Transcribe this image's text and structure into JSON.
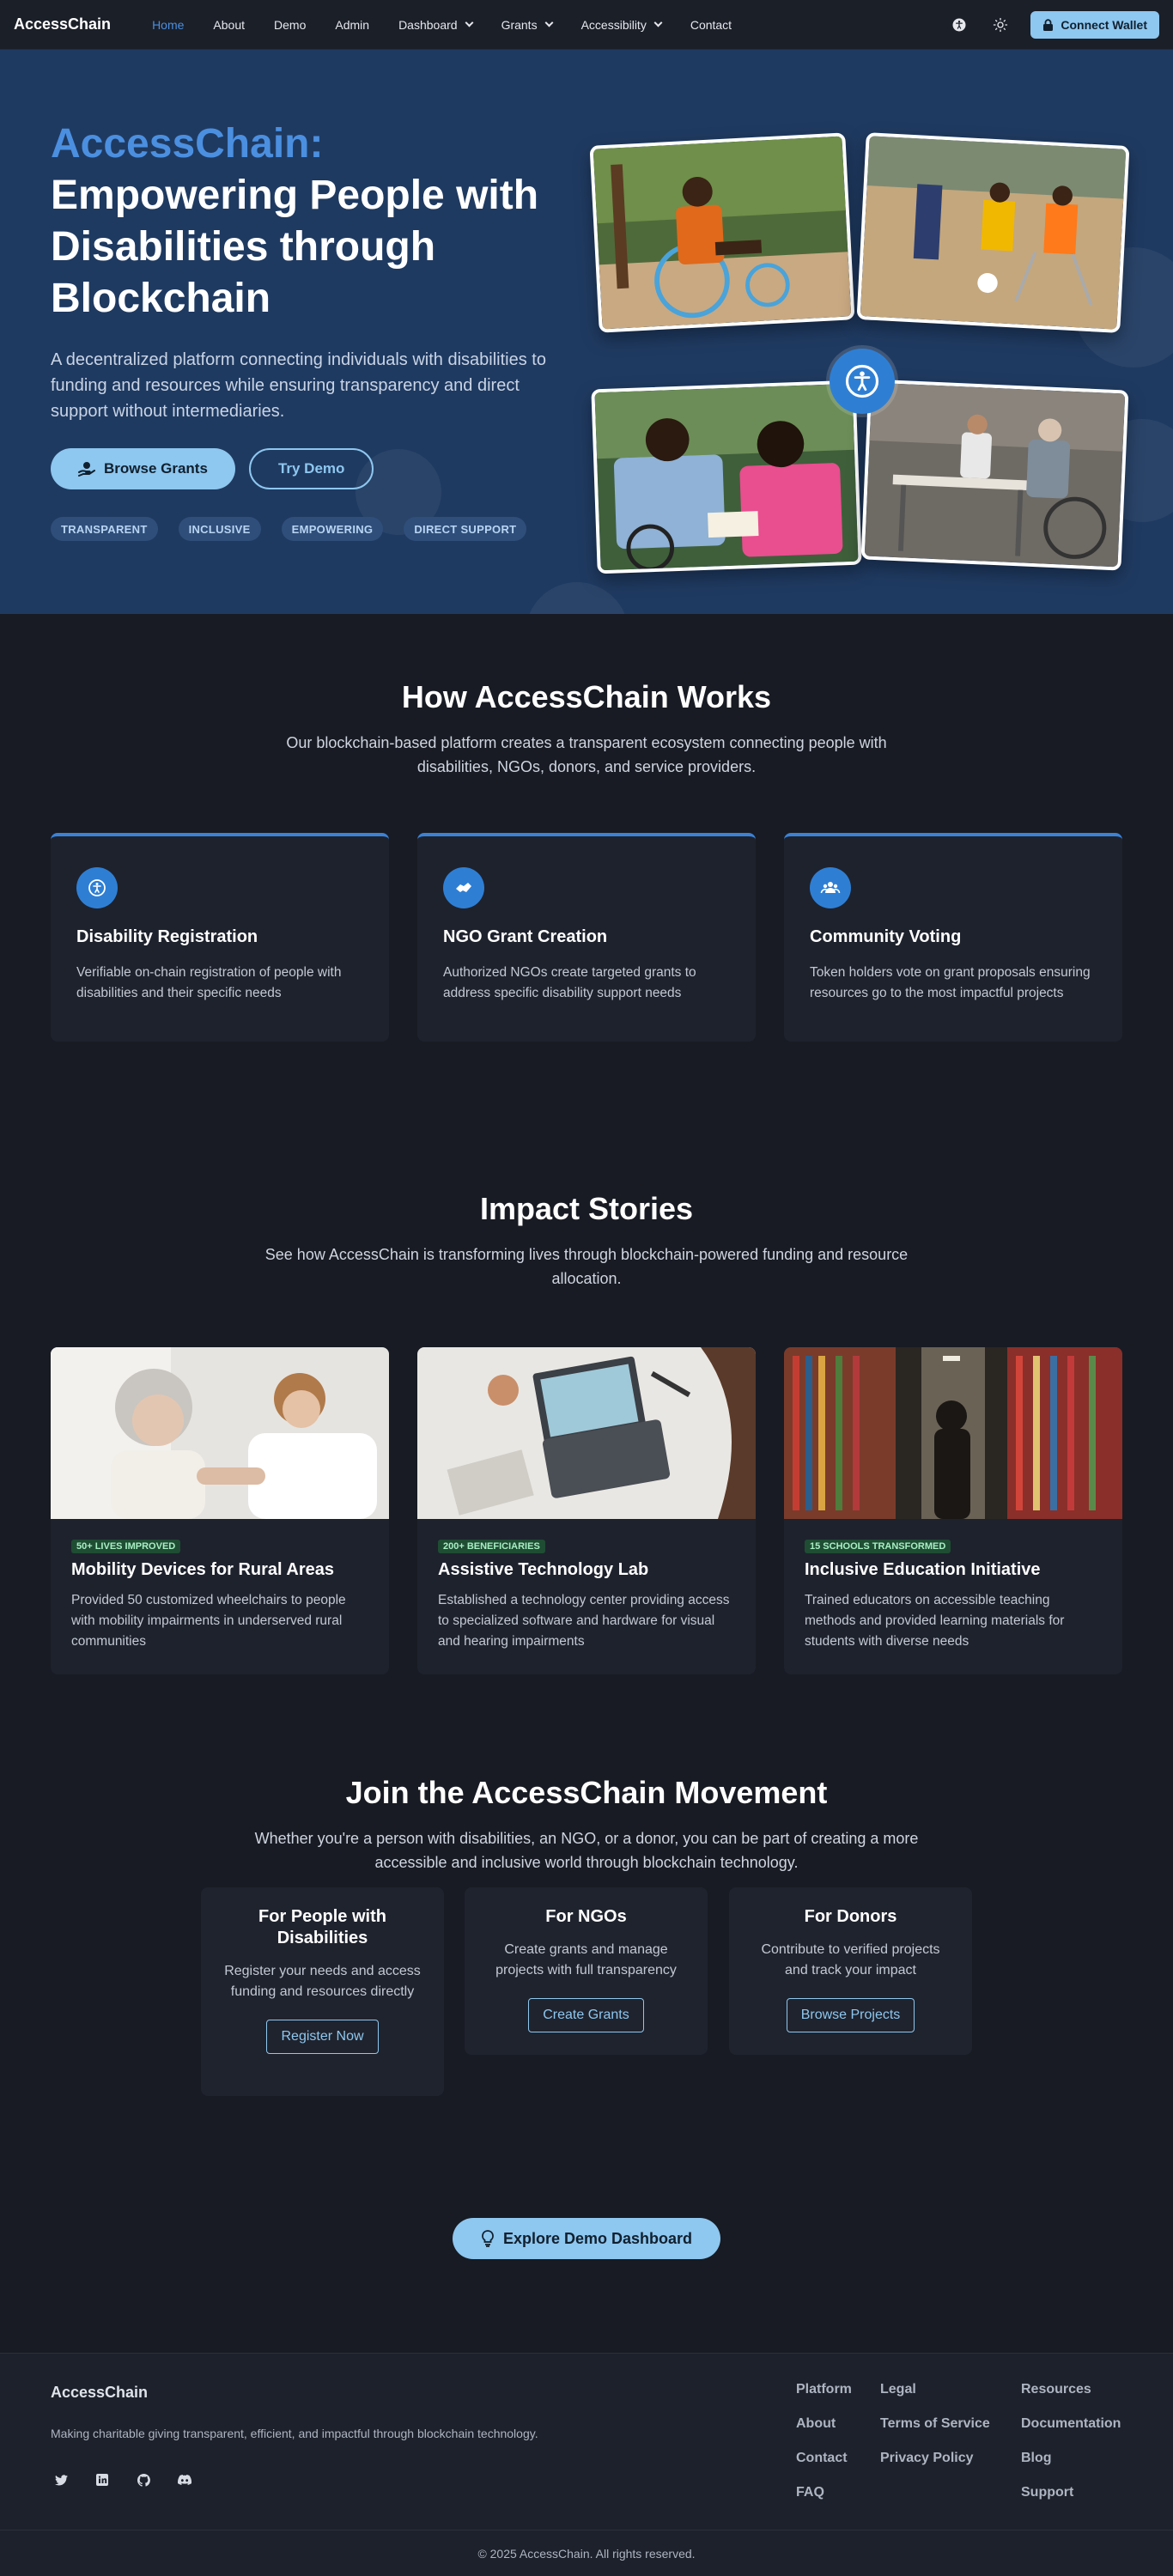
{
  "nav": {
    "brand": "AccessChain",
    "links": [
      "Home",
      "About",
      "Demo",
      "Admin",
      "Dashboard",
      "Grants",
      "Accessibility",
      "Contact"
    ],
    "wallet_label": "Connect Wallet"
  },
  "hero": {
    "title_accent": "AccessChain:",
    "title_main": "Empowering People with Disabilities through Blockchain",
    "description": "A decentralized platform connecting individuals with disabilities to funding and resources while ensuring transparency and direct support without intermediaries.",
    "browse_label": "Browse Grants",
    "demo_label": "Try Demo",
    "tags": [
      "TRANSPARENT",
      "INCLUSIVE",
      "EMPOWERING",
      "DIRECT SUPPORT"
    ]
  },
  "how": {
    "title": "How AccessChain Works",
    "subtitle": "Our blockchain-based platform creates a transparent ecosystem connecting people with disabilities, NGOs, donors, and service providers.",
    "cards": [
      {
        "title": "Disability Registration",
        "text": "Verifiable on-chain registration of people with disabilities and their specific needs"
      },
      {
        "title": "NGO Grant Creation",
        "text": "Authorized NGOs create targeted grants to address specific disability support needs"
      },
      {
        "title": "Community Voting",
        "text": "Token holders vote on grant proposals ensuring resources go to the most impactful projects"
      }
    ]
  },
  "impact": {
    "title": "Impact Stories",
    "subtitle": "See how AccessChain is transforming lives through blockchain-powered funding and resource allocation.",
    "stories": [
      {
        "badge": "50+ LIVES IMPROVED",
        "title": "Mobility Devices for Rural Areas",
        "text": "Provided 50 customized wheelchairs to people with mobility impairments in underserved rural communities"
      },
      {
        "badge": "200+ BENEFICIARIES",
        "title": "Assistive Technology Lab",
        "text": "Established a technology center providing access to specialized software and hardware for visual and hearing impairments"
      },
      {
        "badge": "15 SCHOOLS TRANSFORMED",
        "title": "Inclusive Education Initiative",
        "text": "Trained educators on accessible teaching methods and provided learning materials for students with diverse needs"
      }
    ]
  },
  "join": {
    "title": "Join the AccessChain Movement",
    "subtitle": "Whether you're a person with disabilities, an NGO, or a donor, you can be part of creating a more accessible and inclusive world through blockchain technology.",
    "cards": [
      {
        "title": "For People with Disabilities",
        "text": "Register your needs and access funding and resources directly",
        "button": "Register Now"
      },
      {
        "title": "For NGOs",
        "text": "Create grants and manage projects with full transparency",
        "button": "Create Grants"
      },
      {
        "title": "For Donors",
        "text": "Contribute to verified projects and track your impact",
        "button": "Browse Projects"
      }
    ],
    "demo_button": "Explore Demo Dashboard"
  },
  "footer": {
    "brand": "AccessChain",
    "description": "Making charitable giving transparent, efficient, and impactful through blockchain technology.",
    "columns": [
      {
        "heading": "Platform",
        "links": [
          "About",
          "Contact",
          "FAQ"
        ]
      },
      {
        "heading": "Legal",
        "links": [
          "Terms of Service",
          "Privacy Policy"
        ]
      },
      {
        "heading": "Resources",
        "links": [
          "Documentation",
          "Blog",
          "Support"
        ]
      }
    ],
    "copyright": "© 2025 AccessChain. All rights reserved."
  },
  "colors": {
    "accent": "#4b8fe0",
    "button": "#8ec7ef",
    "hero_bg": "#1f3a61",
    "page_bg": "#181b23"
  }
}
